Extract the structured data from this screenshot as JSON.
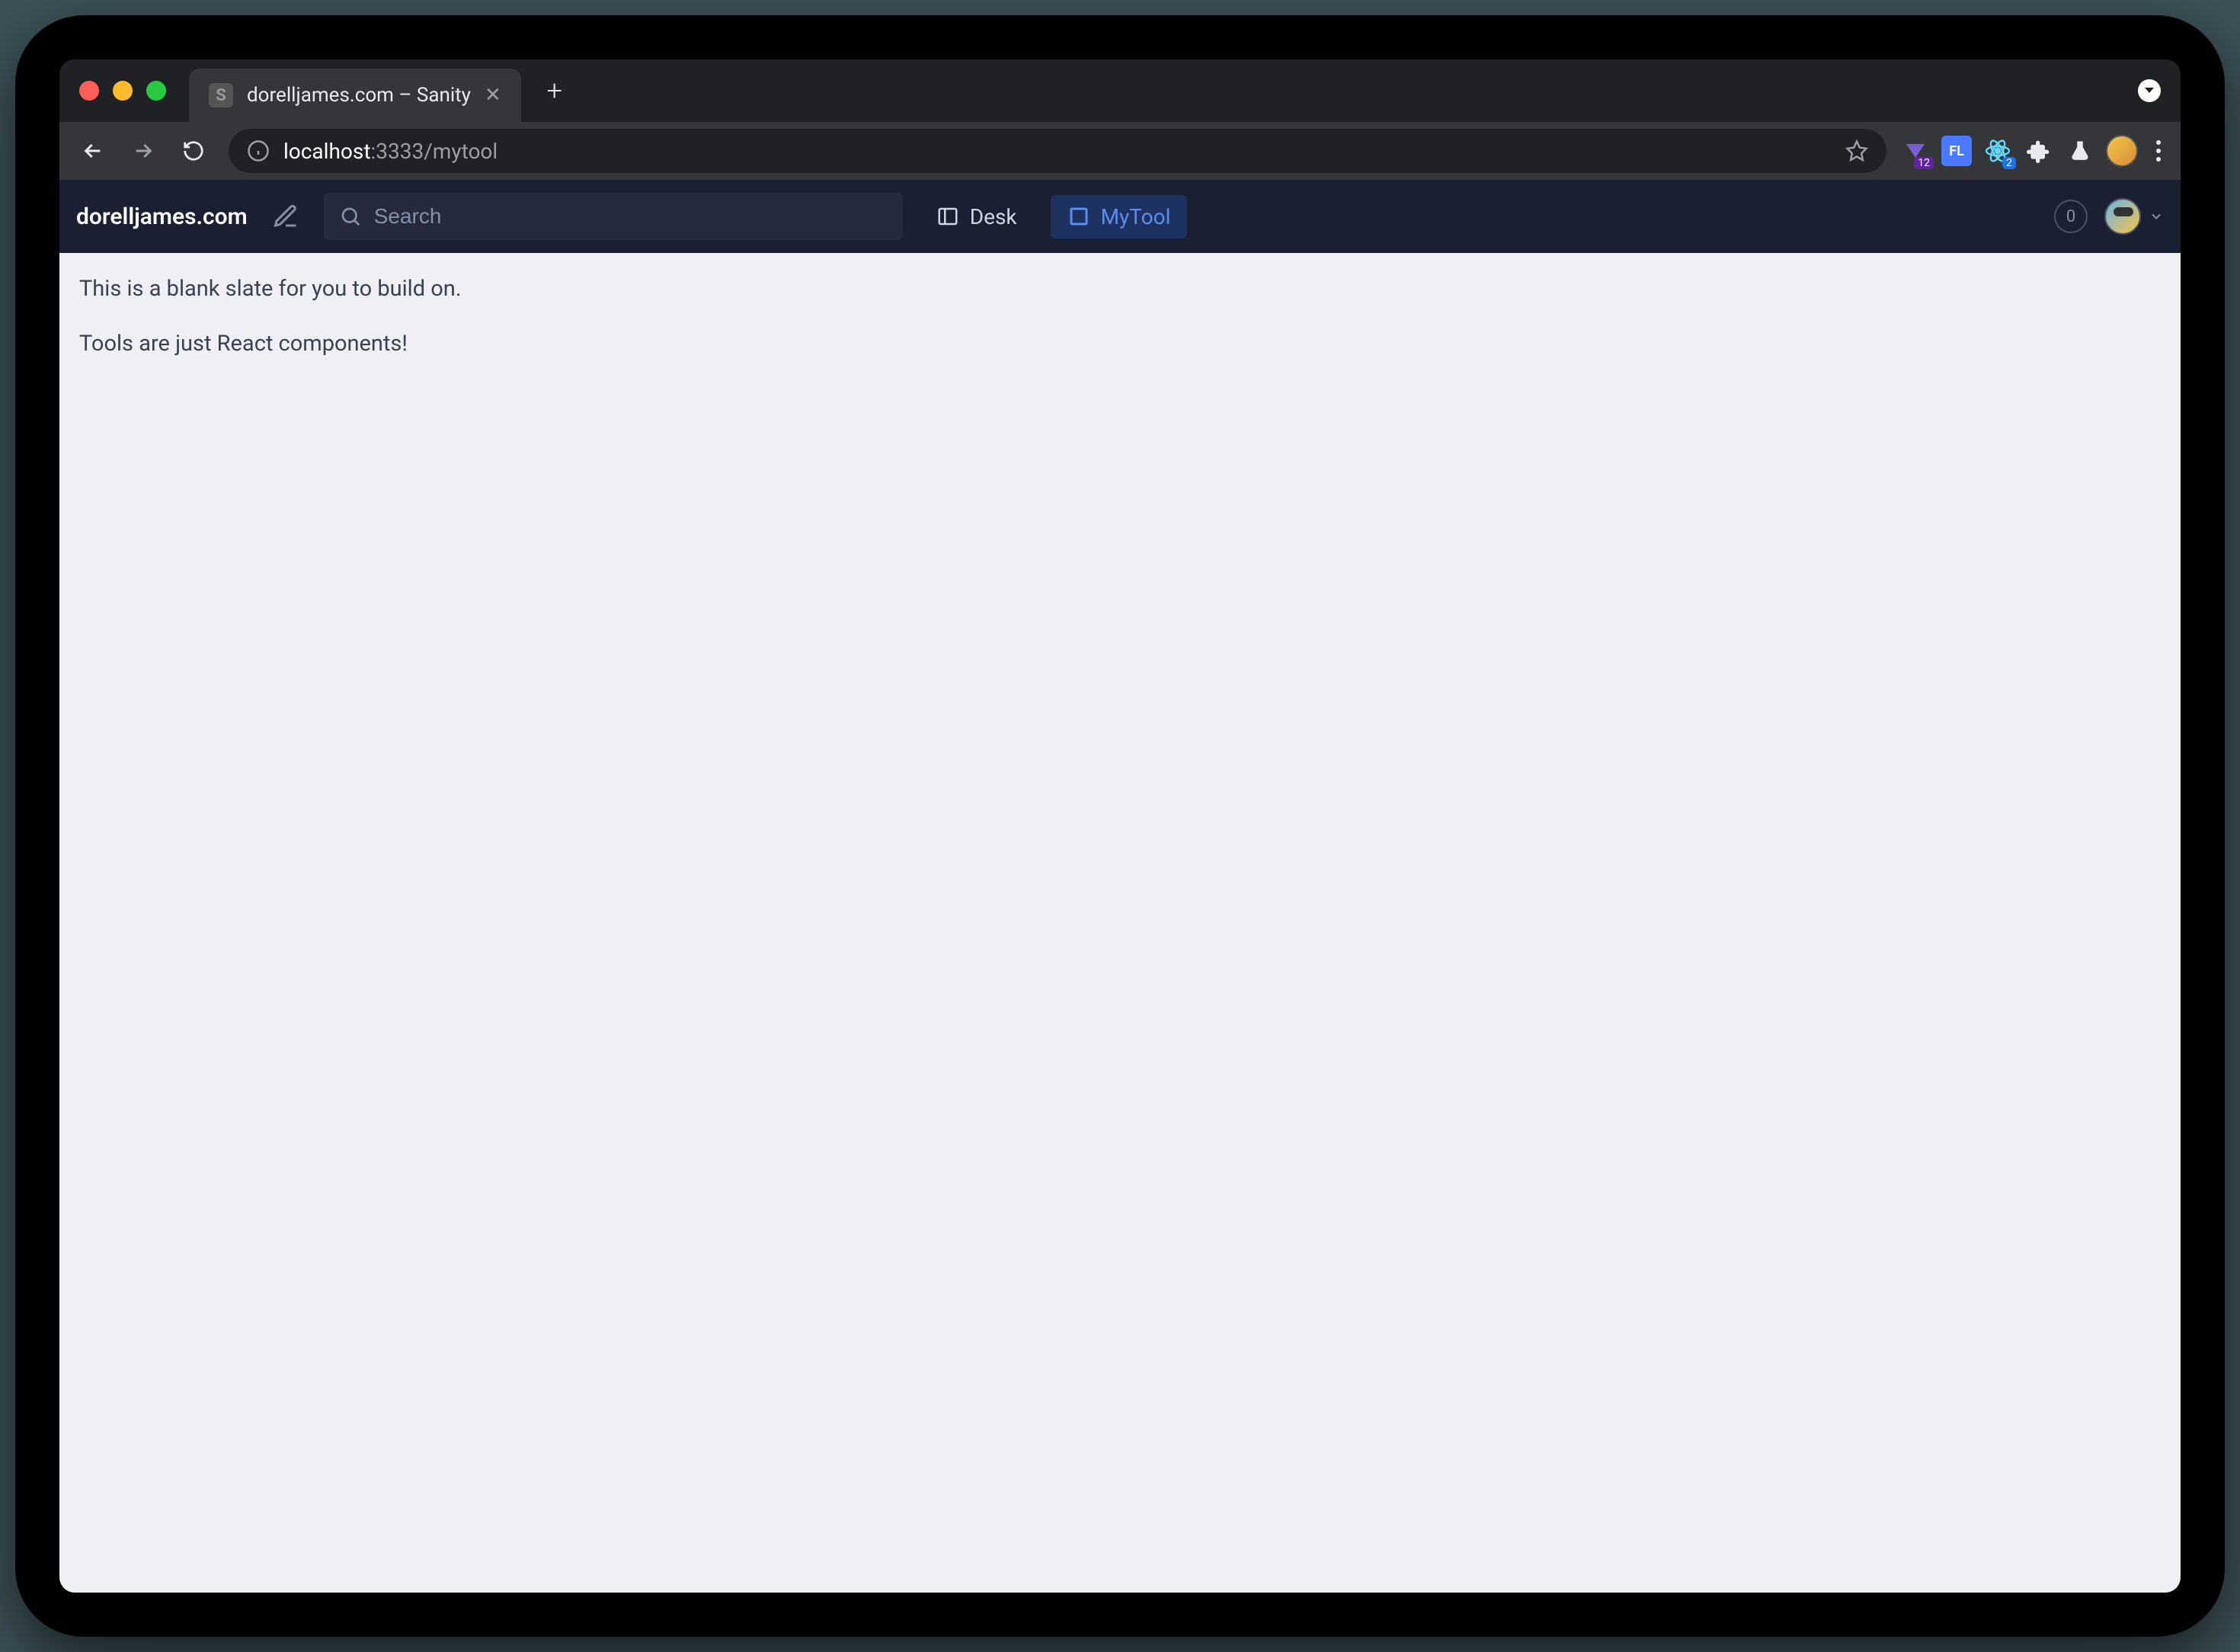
{
  "browser": {
    "tab_title": "dorelljames.com – Sanity",
    "url_host": "localhost",
    "url_path": ":3333/mytool",
    "extensions": {
      "badge_1": "12",
      "badge_2": "2",
      "fl_label": "FL"
    }
  },
  "navbar": {
    "site_title": "dorelljames.com",
    "search_placeholder": "Search",
    "tabs": [
      {
        "label": "Desk"
      },
      {
        "label": "MyTool"
      }
    ],
    "notif_count": "0"
  },
  "content": {
    "line1": "This is a blank slate for you to build on.",
    "line2": "Tools are just React components!"
  }
}
